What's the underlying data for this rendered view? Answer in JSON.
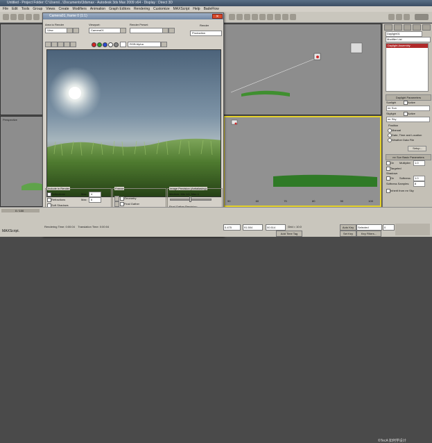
{
  "app": {
    "title": "Untitled   - Project Folder: C:\\Users\\...\\Documents\\3dsmax   - Autodesk 3ds Max 2009 x64   - Display : Direct 3D"
  },
  "menubar": [
    "File",
    "Edit",
    "Tools",
    "Group",
    "Views",
    "Create",
    "Modifiers",
    "Animation",
    "Graph Editors",
    "Rendering",
    "Customize",
    "MAXScript",
    "Help",
    "BadeFlow"
  ],
  "viewports": {
    "bottom_left_label": "Perspective",
    "bottom_right_ruler": [
      "50",
      "60",
      "70",
      "80",
      "90",
      "100"
    ]
  },
  "render_window": {
    "title": "Camera01, frame 0 (1:1)",
    "close_glyph": "✕",
    "area_to_render_label": "Area to Render",
    "area_to_render_value": "View",
    "viewport_label": "Viewport:",
    "viewport_value": "Camera01",
    "render_preset_label": "Render Preset:",
    "render_preset_value": "",
    "render_button": "Render",
    "production_value": "Production",
    "channel_value": "RGB Alpha",
    "include_group": {
      "title": "Include in Render",
      "items": [
        "Reflections",
        "Refractions",
        "Soft Shadows",
        "Final Gather",
        "Subset Pixels (of selected objects)"
      ],
      "max_label1": "Max:",
      "max_val1": "4",
      "max_label2": "Max:",
      "max_val2": "6",
      "bounces_label": "Bounces:",
      "bounces_val": "0"
    },
    "freeze_group": {
      "title": "Freeze",
      "items": [
        "Geometry",
        "Final Gather"
      ],
      "clear_button": "Clear All"
    },
    "precision_group": {
      "title": "Image Precision (Antialiasing)",
      "min_label": "Medium: Min 1/4, Max 4",
      "fg_label": "Final Gather Precision:",
      "custom_label": "Custom"
    },
    "status": {
      "rendering_time": "Rendering Time: 0:00:04",
      "translation_time": "Translation Time: 0:00:04"
    }
  },
  "cmd_panel": {
    "object_name": "Daylight01",
    "modifier_list": "Modifier List",
    "stack_item": "Daylight Assembly",
    "daylight_params_title": "Daylight Parameters",
    "sunlight_label": "Sunlight",
    "sunlight_active": "Active",
    "sunlight_value": "mr Sun",
    "skylight_label": "Skylight",
    "skylight_active": "Active",
    "skylight_value": "mr Sky",
    "position_title": "Position",
    "position_options": [
      "Manual",
      "Date, Time and Location",
      "Weather Data File"
    ],
    "setup_button": "Setup...",
    "sun_basic_title": "mr Sun Basic Parameters",
    "on_label": "On",
    "multiplier_label": "Multiplier",
    "multiplier_value": "1.0",
    "targeted_label": "Targeted",
    "shadows_label": "Shadows",
    "softness_label": "Softness:",
    "softness_value": "1.0",
    "softness_samples_label": "Softness Samples:",
    "softness_samples_value": "8",
    "inherit_label": "Inherit from mr Sky"
  },
  "bottom": {
    "maxscript_label": "MAXScript.",
    "script_field": "",
    "coord_x": "0.475",
    "coord_y": "91.504",
    "coord_z": "00.514",
    "grid_label": "Grid = 10.0",
    "auto_key": "Auto Key",
    "selected": "Selected",
    "set_key": "Set Key",
    "key_filters": "Key Filters...",
    "add_time_tag": "Add Time Tag",
    "frame_value": "0",
    "slider_label": "0 / 100",
    "watermark": "©TecA 如何学设计"
  }
}
